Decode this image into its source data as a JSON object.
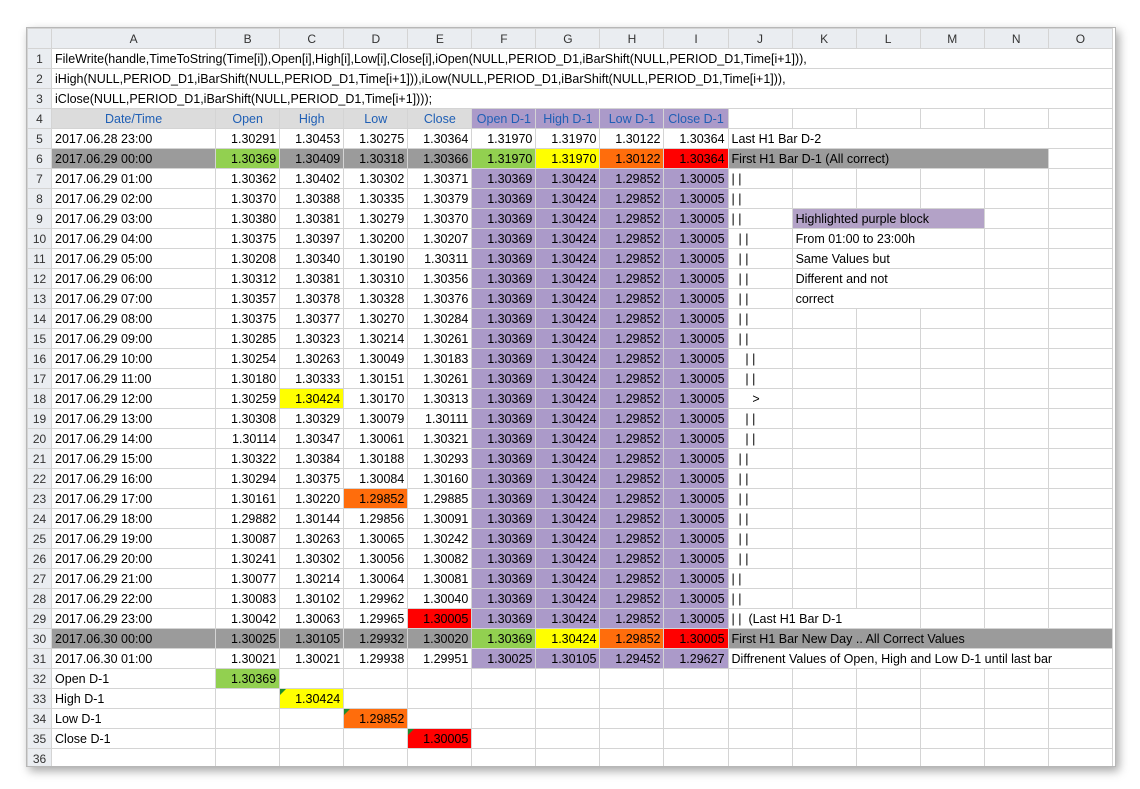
{
  "columns": [
    "A",
    "B",
    "C",
    "D",
    "E",
    "F",
    "G",
    "H",
    "I",
    "J",
    "K",
    "L",
    "M",
    "N",
    "O"
  ],
  "code_lines": [
    "FileWrite(handle,TimeToString(Time[i]),Open[i],High[i],Low[i],Close[i],iOpen(NULL,PERIOD_D1,iBarShift(NULL,PERIOD_D1,Time[i+1])),",
    "iHigh(NULL,PERIOD_D1,iBarShift(NULL,PERIOD_D1,Time[i+1])),iLow(NULL,PERIOD_D1,iBarShift(NULL,PERIOD_D1,Time[i+1])),",
    "iClose(NULL,PERIOD_D1,iBarShift(NULL,PERIOD_D1,Time[i+1])));"
  ],
  "headers": [
    "Date/Time",
    "Open",
    "High",
    "Low",
    "Close",
    "Open D-1",
    "High D-1",
    "Low D-1",
    "Close D-1"
  ],
  "rows": [
    {
      "n": "5",
      "c": [
        "2017.06.28 23:00",
        "1.30291",
        "1.30453",
        "1.30275",
        "1.30364",
        "1.31970",
        "1.31970",
        "1.30122",
        "1.30364"
      ],
      "note": "Last H1 Bar D-2"
    },
    {
      "n": "6",
      "c": [
        "2017.06.29 00:00",
        "1.30369",
        "1.30409",
        "1.30318",
        "1.30366",
        "1.31970",
        "1.31970",
        "1.30122",
        "1.30364"
      ],
      "note": "First H1 Bar D-1 (All correct)"
    },
    {
      "n": "7",
      "c": [
        "2017.06.29 01:00",
        "1.30362",
        "1.30402",
        "1.30302",
        "1.30371",
        "1.30369",
        "1.30424",
        "1.29852",
        "1.30005"
      ],
      "note": "| |"
    },
    {
      "n": "8",
      "c": [
        "2017.06.29 02:00",
        "1.30370",
        "1.30388",
        "1.30335",
        "1.30379",
        "1.30369",
        "1.30424",
        "1.29852",
        "1.30005"
      ],
      "note": "| |"
    },
    {
      "n": "9",
      "c": [
        "2017.06.29 03:00",
        "1.30380",
        "1.30381",
        "1.30279",
        "1.30370",
        "1.30369",
        "1.30424",
        "1.29852",
        "1.30005"
      ],
      "note": "| |"
    },
    {
      "n": "10",
      "c": [
        "2017.06.29 04:00",
        "1.30375",
        "1.30397",
        "1.30200",
        "1.30207",
        "1.30369",
        "1.30424",
        "1.29852",
        "1.30005"
      ],
      "note": "  | |"
    },
    {
      "n": "11",
      "c": [
        "2017.06.29 05:00",
        "1.30208",
        "1.30340",
        "1.30190",
        "1.30311",
        "1.30369",
        "1.30424",
        "1.29852",
        "1.30005"
      ],
      "note": "  | |"
    },
    {
      "n": "12",
      "c": [
        "2017.06.29 06:00",
        "1.30312",
        "1.30381",
        "1.30310",
        "1.30356",
        "1.30369",
        "1.30424",
        "1.29852",
        "1.30005"
      ],
      "note": "  | |"
    },
    {
      "n": "13",
      "c": [
        "2017.06.29 07:00",
        "1.30357",
        "1.30378",
        "1.30328",
        "1.30376",
        "1.30369",
        "1.30424",
        "1.29852",
        "1.30005"
      ],
      "note": "  | |"
    },
    {
      "n": "14",
      "c": [
        "2017.06.29 08:00",
        "1.30375",
        "1.30377",
        "1.30270",
        "1.30284",
        "1.30369",
        "1.30424",
        "1.29852",
        "1.30005"
      ],
      "note": "  | |"
    },
    {
      "n": "15",
      "c": [
        "2017.06.29 09:00",
        "1.30285",
        "1.30323",
        "1.30214",
        "1.30261",
        "1.30369",
        "1.30424",
        "1.29852",
        "1.30005"
      ],
      "note": "  | |"
    },
    {
      "n": "16",
      "c": [
        "2017.06.29 10:00",
        "1.30254",
        "1.30263",
        "1.30049",
        "1.30183",
        "1.30369",
        "1.30424",
        "1.29852",
        "1.30005"
      ],
      "note": "    | |"
    },
    {
      "n": "17",
      "c": [
        "2017.06.29 11:00",
        "1.30180",
        "1.30333",
        "1.30151",
        "1.30261",
        "1.30369",
        "1.30424",
        "1.29852",
        "1.30005"
      ],
      "note": "    | |"
    },
    {
      "n": "18",
      "c": [
        "2017.06.29 12:00",
        "1.30259",
        "1.30424",
        "1.30170",
        "1.30313",
        "1.30369",
        "1.30424",
        "1.29852",
        "1.30005"
      ],
      "note": "      >"
    },
    {
      "n": "19",
      "c": [
        "2017.06.29 13:00",
        "1.30308",
        "1.30329",
        "1.30079",
        "1.30111",
        "1.30369",
        "1.30424",
        "1.29852",
        "1.30005"
      ],
      "note": "    | |"
    },
    {
      "n": "20",
      "c": [
        "2017.06.29 14:00",
        "1.30114",
        "1.30347",
        "1.30061",
        "1.30321",
        "1.30369",
        "1.30424",
        "1.29852",
        "1.30005"
      ],
      "note": "    | |"
    },
    {
      "n": "21",
      "c": [
        "2017.06.29 15:00",
        "1.30322",
        "1.30384",
        "1.30188",
        "1.30293",
        "1.30369",
        "1.30424",
        "1.29852",
        "1.30005"
      ],
      "note": "  | |"
    },
    {
      "n": "22",
      "c": [
        "2017.06.29 16:00",
        "1.30294",
        "1.30375",
        "1.30084",
        "1.30160",
        "1.30369",
        "1.30424",
        "1.29852",
        "1.30005"
      ],
      "note": "  | |"
    },
    {
      "n": "23",
      "c": [
        "2017.06.29 17:00",
        "1.30161",
        "1.30220",
        "1.29852",
        "1.29885",
        "1.30369",
        "1.30424",
        "1.29852",
        "1.30005"
      ],
      "note": "  | |"
    },
    {
      "n": "24",
      "c": [
        "2017.06.29 18:00",
        "1.29882",
        "1.30144",
        "1.29856",
        "1.30091",
        "1.30369",
        "1.30424",
        "1.29852",
        "1.30005"
      ],
      "note": "  | |"
    },
    {
      "n": "25",
      "c": [
        "2017.06.29 19:00",
        "1.30087",
        "1.30263",
        "1.30065",
        "1.30242",
        "1.30369",
        "1.30424",
        "1.29852",
        "1.30005"
      ],
      "note": "  | |"
    },
    {
      "n": "26",
      "c": [
        "2017.06.29 20:00",
        "1.30241",
        "1.30302",
        "1.30056",
        "1.30082",
        "1.30369",
        "1.30424",
        "1.29852",
        "1.30005"
      ],
      "note": "  | |"
    },
    {
      "n": "27",
      "c": [
        "2017.06.29 21:00",
        "1.30077",
        "1.30214",
        "1.30064",
        "1.30081",
        "1.30369",
        "1.30424",
        "1.29852",
        "1.30005"
      ],
      "note": "| |"
    },
    {
      "n": "28",
      "c": [
        "2017.06.29 22:00",
        "1.30083",
        "1.30102",
        "1.29962",
        "1.30040",
        "1.30369",
        "1.30424",
        "1.29852",
        "1.30005"
      ],
      "note": "| |"
    },
    {
      "n": "29",
      "c": [
        "2017.06.29 23:00",
        "1.30042",
        "1.30063",
        "1.29965",
        "1.30005",
        "1.30369",
        "1.30424",
        "1.29852",
        "1.30005"
      ],
      "note": "| |  (Last H1 Bar D-1"
    },
    {
      "n": "30",
      "c": [
        "2017.06.30 00:00",
        "1.30025",
        "1.30105",
        "1.29932",
        "1.30020",
        "1.30369",
        "1.30424",
        "1.29852",
        "1.30005"
      ],
      "note": "First H1 Bar New Day .. All Correct Values"
    },
    {
      "n": "31",
      "c": [
        "2017.06.30 01:00",
        "1.30021",
        "1.30021",
        "1.29938",
        "1.29951",
        "1.30025",
        "1.30105",
        "1.29452",
        "1.29627"
      ],
      "note": "Diffrenent Values of Open, High and Low D-1 until last bar"
    }
  ],
  "notes_k": {
    "r9": "Highlighted purple block",
    "r10": "From 01:00 to 23:00h",
    "r11": "Same Values but",
    "r12": "Different and not",
    "r13": "correct"
  },
  "summary": [
    {
      "n": "32",
      "label": "Open D-1",
      "value": "1.30369"
    },
    {
      "n": "33",
      "label": "High D-1",
      "value": "1.30424"
    },
    {
      "n": "34",
      "label": "Low D-1",
      "value": "1.29852"
    },
    {
      "n": "35",
      "label": "Close D-1",
      "value": "1.30005"
    }
  ],
  "last_row_n": "36",
  "colors": {
    "purple": "#ab9ac9",
    "gray": "#9b9b9b",
    "green": "#92d050",
    "yellow": "#ffff00",
    "orange": "#ff6d0c",
    "red": "#ff0000",
    "header_text": "#1f5fb5"
  }
}
